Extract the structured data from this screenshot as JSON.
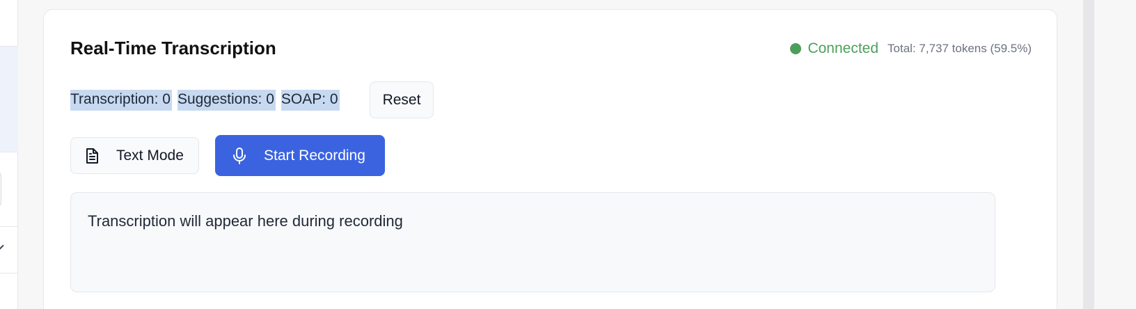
{
  "card": {
    "title": "Real-Time Transcription"
  },
  "status": {
    "label": "Connected",
    "tokens": "Total: 7,737 tokens (59.5%)",
    "color": "#4c9f5b"
  },
  "counters": [
    {
      "label": "Transcription: 0"
    },
    {
      "label": "Suggestions: 0"
    },
    {
      "label": "SOAP: 0"
    }
  ],
  "buttons": {
    "reset": "Reset",
    "text_mode": "Text Mode",
    "text_mode_icon": "document-icon",
    "start_recording": "Start Recording",
    "start_recording_icon": "microphone-icon",
    "accent_color": "#3b63e0"
  },
  "transcript": {
    "placeholder": "Transcription will appear here during recording"
  }
}
